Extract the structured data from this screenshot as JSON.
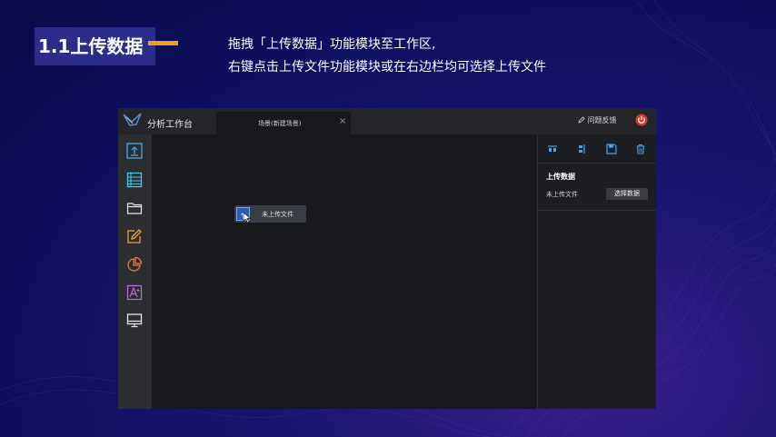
{
  "slide": {
    "heading": "1.1上传数据",
    "desc_line1": "拖拽「上传数据」功能模块至工作区,",
    "desc_line2": "右键点击上传文件功能模块或在右边栏均可选择上传文件",
    "accent_color": "#f39a2b"
  },
  "app": {
    "title": "分析工作台",
    "tab_label": "场景(新建场景)",
    "tab_close": "×",
    "feedback_label": "问题反馈",
    "left_icons": [
      "upload-icon",
      "table-icon",
      "folder-icon",
      "edit-icon",
      "pie-chart-icon",
      "text-style-icon",
      "monitor-icon"
    ],
    "node_label": "未上传文件",
    "right_panel": {
      "tools": [
        "align-top-icon",
        "align-vertical-icon",
        "save-icon",
        "trash-icon"
      ],
      "heading": "上传数据",
      "status": "未上传文件",
      "select_button": "选择数据"
    }
  }
}
